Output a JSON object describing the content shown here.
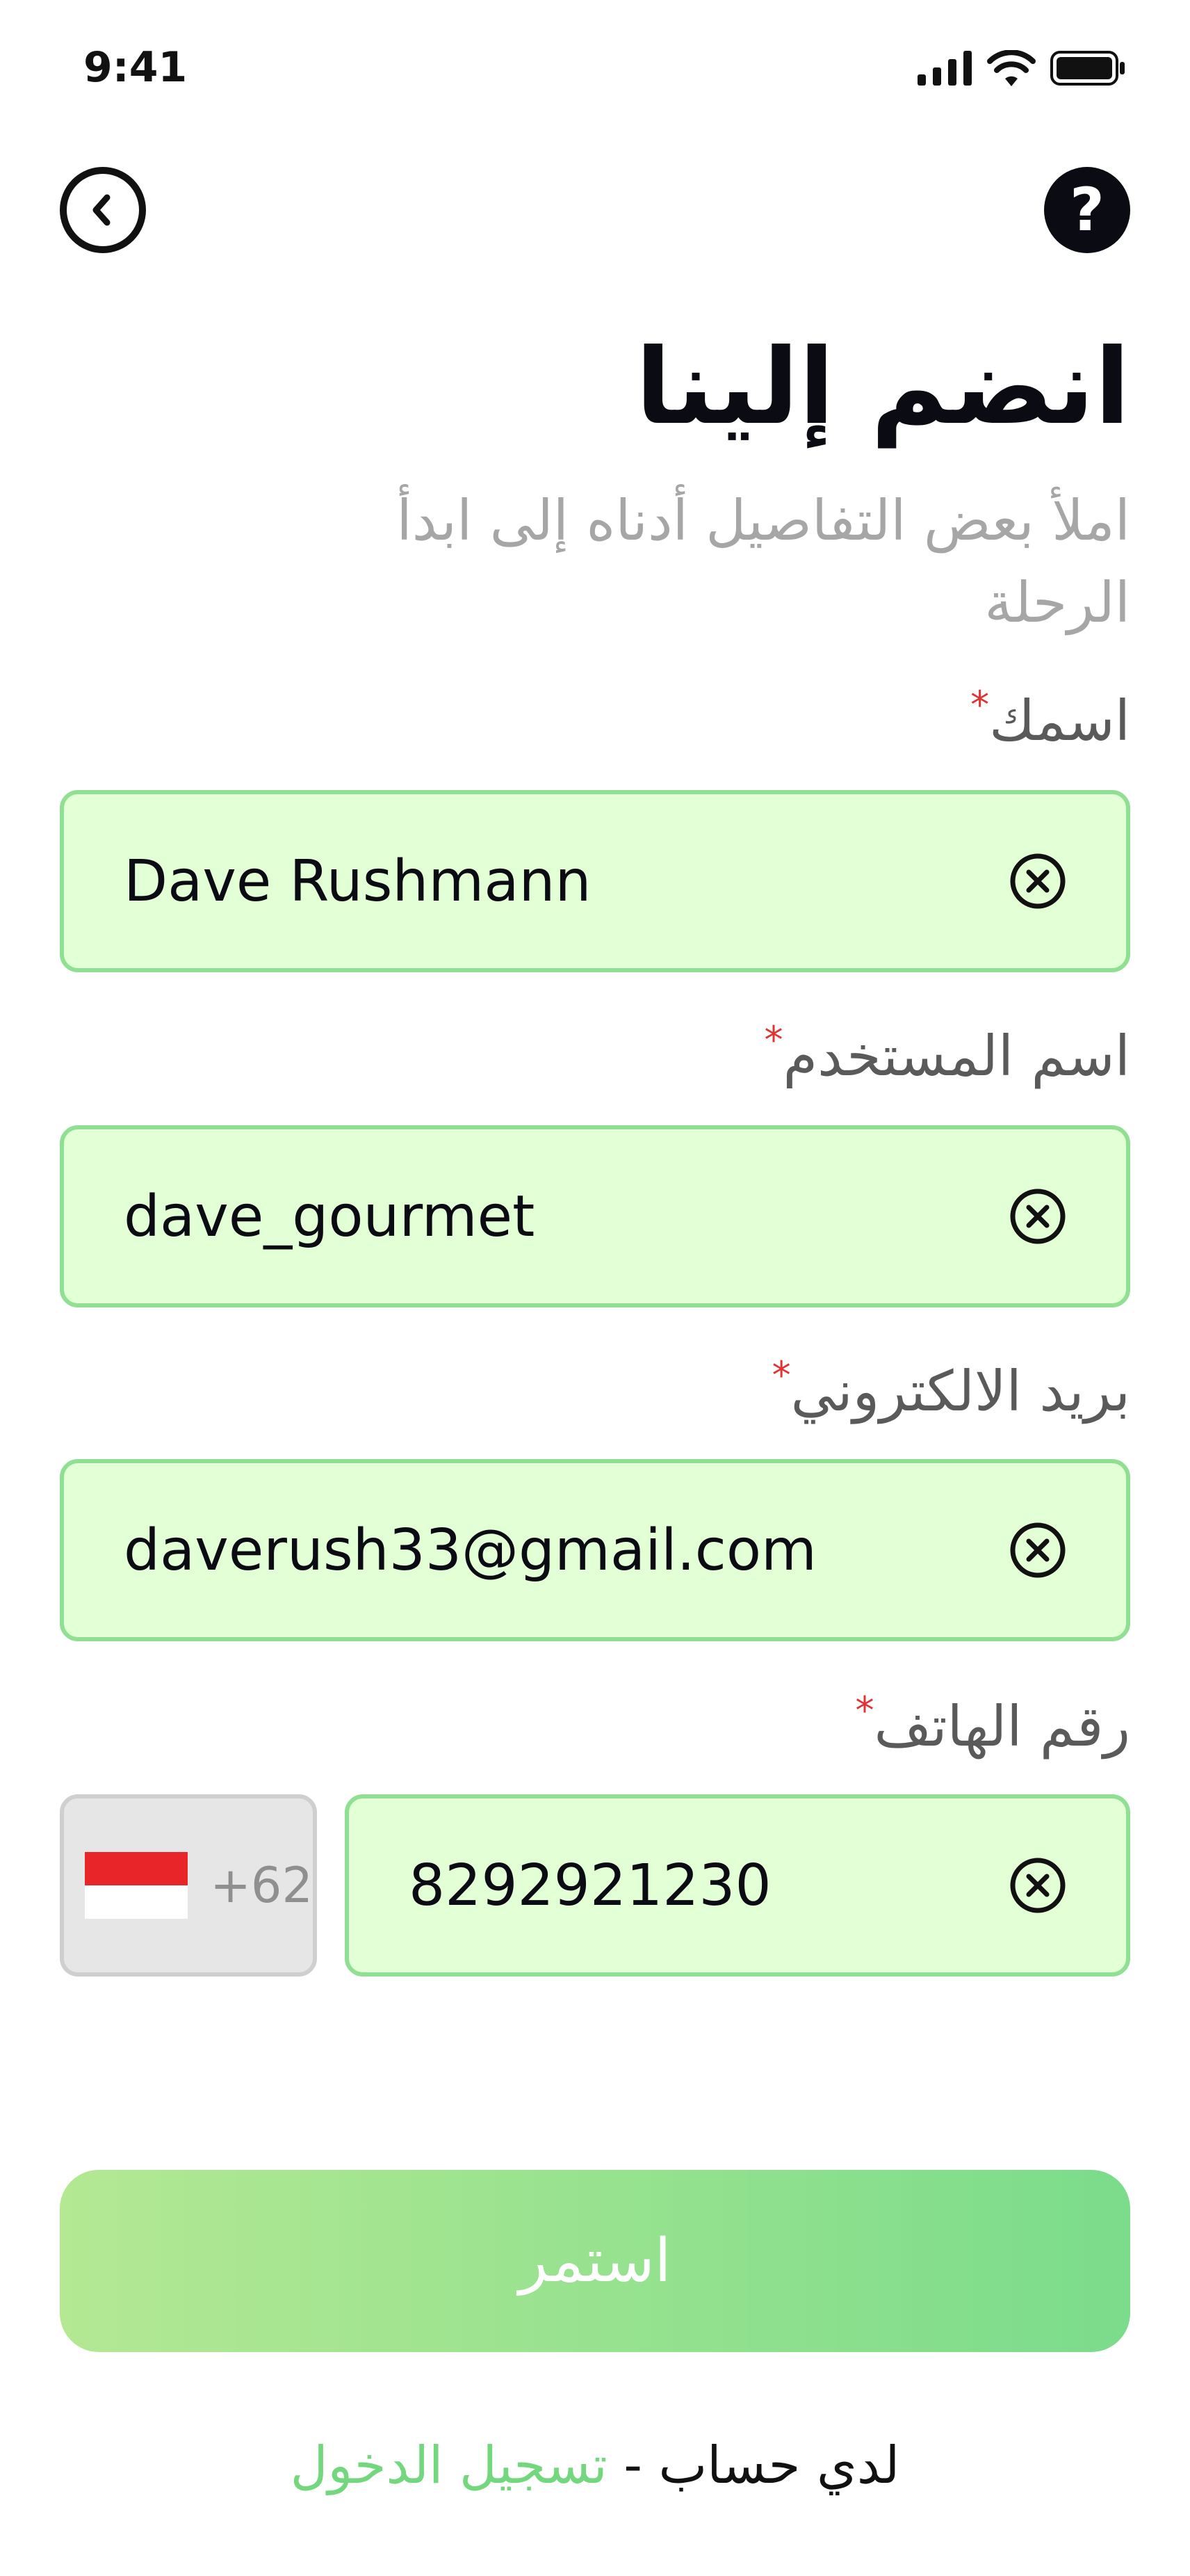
{
  "status_bar": {
    "time": "9:41"
  },
  "header": {
    "back_icon": "chevron-left-icon",
    "help_icon": "help-icon",
    "help_glyph": "?"
  },
  "title": "انضم إلينا",
  "subtitle": "املأ بعض التفاصيل أدناه إلى ابدأ الرحلة",
  "required_mark": "*",
  "fields": {
    "name": {
      "label": "اسمك",
      "value": "Dave Rushmann"
    },
    "username": {
      "label": "اسم المستخدم",
      "value": "dave_gourmet"
    },
    "email": {
      "label": "بريد الالكتروني",
      "value": "daverush33@gmail.com"
    },
    "phone": {
      "label": "رقم الهاتف",
      "country_code": "+62",
      "value": "8292921230"
    }
  },
  "continue_label": "استمر",
  "footer": {
    "have_account": "لدي حساب",
    "separator": " - ",
    "login": "تسجيل الدخول"
  },
  "colors": {
    "field_fill": "#e3ffd6",
    "field_border": "#8fe092",
    "accent": "#73d77e",
    "required": "#e03434"
  }
}
